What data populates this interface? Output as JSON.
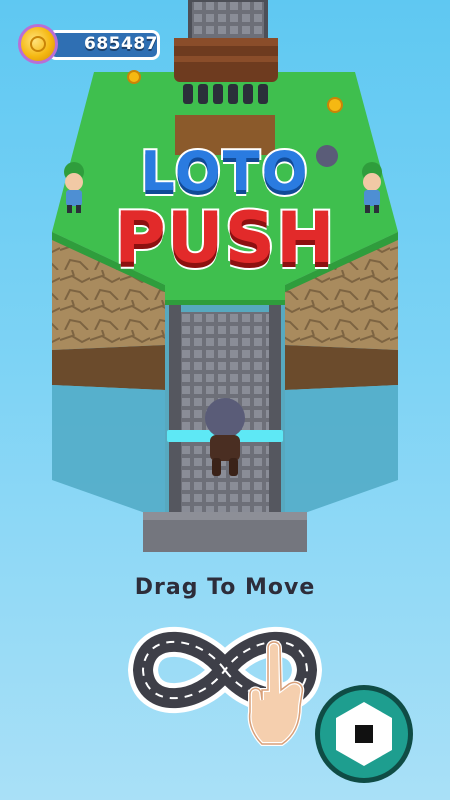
{
  "hud": {
    "coins": "685487",
    "coin_icon": "coin-icon"
  },
  "logo": {
    "line1": "LOTO",
    "line2": "PUSH"
  },
  "tutorial": {
    "instruction": "Drag To Move",
    "gesture_icon": "infinity-swipe-icon",
    "hand_icon": "pointing-hand-icon"
  },
  "controls": {
    "record_icon": "stop-record-icon"
  },
  "colors": {
    "sky": "#6fcdf4",
    "grass": "#3fbf4e",
    "logo_blue": "#2a7be0",
    "logo_red": "#e22a2a",
    "button_teal": "#1e9e8f"
  }
}
